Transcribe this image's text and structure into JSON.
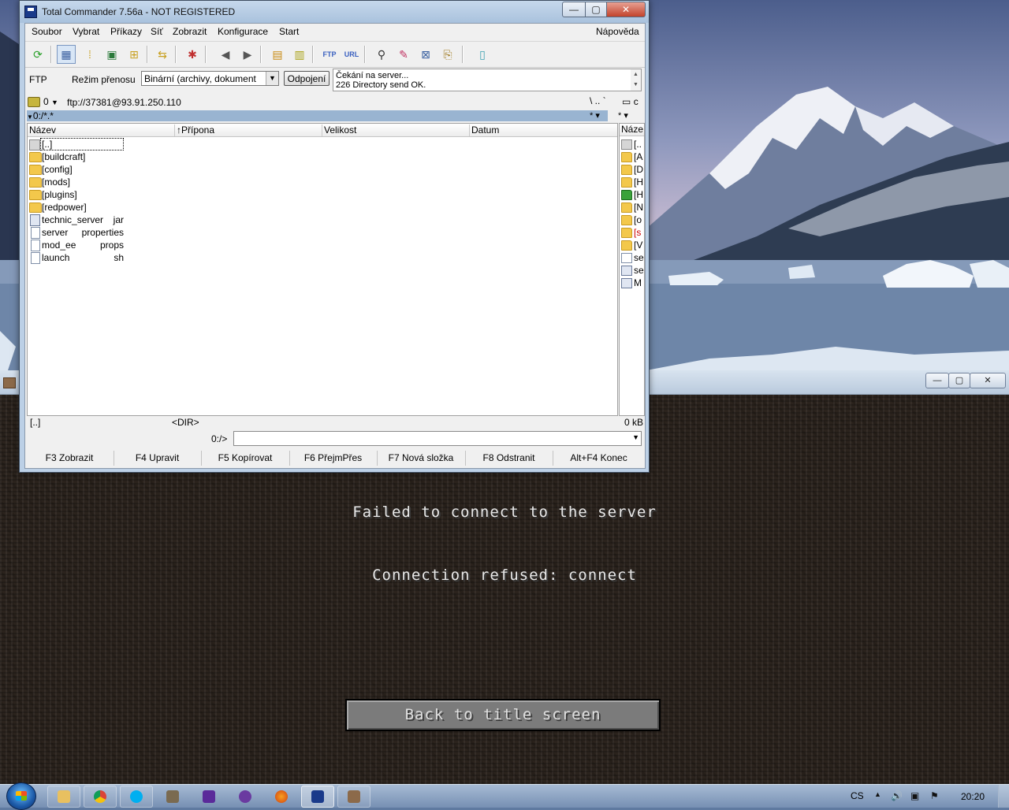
{
  "total_commander": {
    "title": "Total Commander 7.56a - NOT REGISTERED",
    "menu": [
      "Soubor",
      "Vybrat",
      "Příkazy",
      "Síť",
      "Zobrazit",
      "Konfigurace",
      "Start"
    ],
    "menu_help": "Nápověda",
    "ftp": {
      "label": "FTP",
      "transfer_mode_label": "Režim přenosu",
      "transfer_mode_value": "Binární (archivy, dokument",
      "disconnect_label": "Odpojení",
      "log": [
        "Čekání na server...",
        "226 Directory send OK."
      ]
    },
    "path": {
      "drive": "0",
      "address": "ftp://37381@93.91.250.110",
      "tools": "\\  ..  `",
      "right_drive": "c",
      "left_filter": "0:/*.*",
      "filter_stars": "*  ▾",
      "right_filter_stars": "*  ▾"
    },
    "columns": [
      "Název",
      "Přípona",
      "Velikost",
      "Datum"
    ],
    "sort_indicator": "↑",
    "files": [
      {
        "name": "[..]",
        "ext": "",
        "icon": "up-icon"
      },
      {
        "name": "[buildcraft]",
        "ext": "",
        "icon": "folder-icon"
      },
      {
        "name": "[config]",
        "ext": "",
        "icon": "folder-icon"
      },
      {
        "name": "[mods]",
        "ext": "",
        "icon": "folder-icon"
      },
      {
        "name": "[plugins]",
        "ext": "",
        "icon": "folder-icon"
      },
      {
        "name": "[redpower]",
        "ext": "",
        "icon": "folder-icon"
      },
      {
        "name": "technic_server",
        "ext": "jar",
        "icon": "jar-icon"
      },
      {
        "name": "server",
        "ext": "properties",
        "icon": "file-icon"
      },
      {
        "name": "mod_ee",
        "ext": "props",
        "icon": "file-icon"
      },
      {
        "name": "launch",
        "ext": "sh",
        "icon": "file-icon"
      }
    ],
    "right_panel": {
      "header": "Náze",
      "rows": [
        {
          "name": "[..",
          "icon": "up-icon"
        },
        {
          "name": "[A",
          "icon": "folder-icon"
        },
        {
          "name": "[D",
          "icon": "folder-icon"
        },
        {
          "name": "[H",
          "icon": "folder-icon"
        },
        {
          "name": "[H",
          "icon": "green-icon"
        },
        {
          "name": "[N",
          "icon": "folder-icon"
        },
        {
          "name": "[o",
          "icon": "folder-icon"
        },
        {
          "name": "[s",
          "icon": "folder-icon",
          "color": "#cc0000"
        },
        {
          "name": "[V",
          "icon": "folder-icon"
        },
        {
          "name": "se",
          "icon": "file-icon"
        },
        {
          "name": "se",
          "icon": "jar-icon"
        },
        {
          "name": "M",
          "icon": "jar-icon"
        }
      ]
    },
    "status": {
      "left_name": "[..]",
      "left_type": "<DIR>",
      "right": "0 kB"
    },
    "command_path": "0:/>",
    "function_keys": [
      "F3 Zobrazit",
      "F4 Upravit",
      "F5 Kopírovat",
      "F6 PřejmPřes",
      "F7 Nová složka",
      "F8 Odstranit",
      "Alt+F4 Konec"
    ]
  },
  "minecraft": {
    "message_title": "Failed to connect to the server",
    "message_detail": "Connection refused: connect",
    "button_label": "Back to title screen"
  },
  "taskbar": {
    "language": "CS",
    "clock": "20:20",
    "apps": [
      "explorer",
      "chrome",
      "skype",
      "gimp",
      "download-manager",
      "app-c",
      "firefox",
      "total-commander",
      "minecraft"
    ]
  }
}
